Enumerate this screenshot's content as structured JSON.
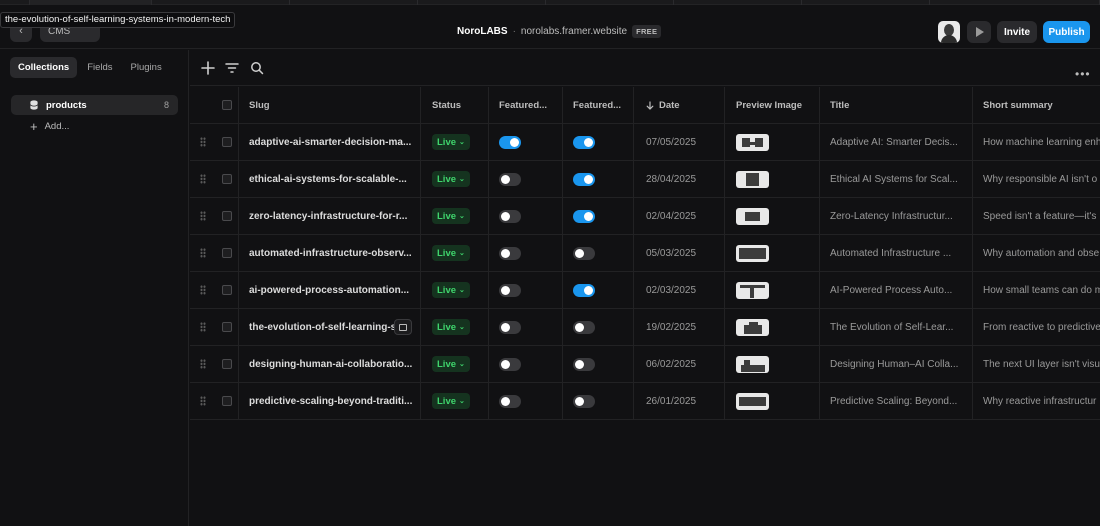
{
  "tooltip": "the-evolution-of-self-learning-systems-in-modern-tech",
  "header": {
    "cms_label": "CMS",
    "brand": "NoroLABS",
    "separator": "·",
    "domain": "norolabs.framer.website",
    "plan": "FREE",
    "invite_label": "Invite",
    "publish_label": "Publish",
    "accent_color": "#1a96ee"
  },
  "sidebar": {
    "tabs": [
      "Collections",
      "Fields",
      "Plugins"
    ],
    "collection": {
      "label": "products",
      "count": "8"
    },
    "add_label": "Add..."
  },
  "columns": {
    "slug": "Slug",
    "status": "Status",
    "featured1": "Featured...",
    "featured2": "Featured...",
    "date": "Date",
    "date_sort_icon": "arrow-down-icon",
    "image": "Preview Image",
    "title": "Title",
    "summary": "Short summary"
  },
  "rows": [
    {
      "slug": "adaptive-ai-smarter-decision-ma...",
      "status": "Live",
      "featured1": true,
      "featured2": true,
      "date": "07/05/2025",
      "title": "Adaptive AI: Smarter Decis...",
      "summary": "How machine learning enh"
    },
    {
      "slug": "ethical-ai-systems-for-scalable-...",
      "status": "Live",
      "featured1": false,
      "featured2": true,
      "date": "28/04/2025",
      "title": "Ethical AI Systems for Scal...",
      "summary": "Why responsible AI isn't o"
    },
    {
      "slug": "zero-latency-infrastructure-for-r...",
      "status": "Live",
      "featured1": false,
      "featured2": true,
      "date": "02/04/2025",
      "title": "Zero-Latency Infrastructur...",
      "summary": "Speed isn't a feature—it's"
    },
    {
      "slug": "automated-infrastructure-observ...",
      "status": "Live",
      "featured1": false,
      "featured2": false,
      "date": "05/03/2025",
      "title": "Automated Infrastructure ...",
      "summary": "Why automation and obse"
    },
    {
      "slug": "ai-powered-process-automation...",
      "status": "Live",
      "featured1": false,
      "featured2": true,
      "date": "02/03/2025",
      "title": "AI-Powered Process Auto...",
      "summary": "How small teams can do m"
    },
    {
      "slug": "the-evolution-of-self-learning-s",
      "status": "Live",
      "featured1": false,
      "featured2": false,
      "date": "19/02/2025",
      "title": "The Evolution of Self-Lear...",
      "summary": "From reactive to predictive"
    },
    {
      "slug": "designing-human-ai-collaboratio...",
      "status": "Live",
      "featured1": false,
      "featured2": false,
      "date": "06/02/2025",
      "title": "Designing Human–AI Colla...",
      "summary": "The next UI layer isn't visu"
    },
    {
      "slug": "predictive-scaling-beyond-traditi...",
      "status": "Live",
      "featured1": false,
      "featured2": false,
      "date": "26/01/2025",
      "title": "Predictive Scaling: Beyond...",
      "summary": "Why reactive infrastructur"
    }
  ]
}
